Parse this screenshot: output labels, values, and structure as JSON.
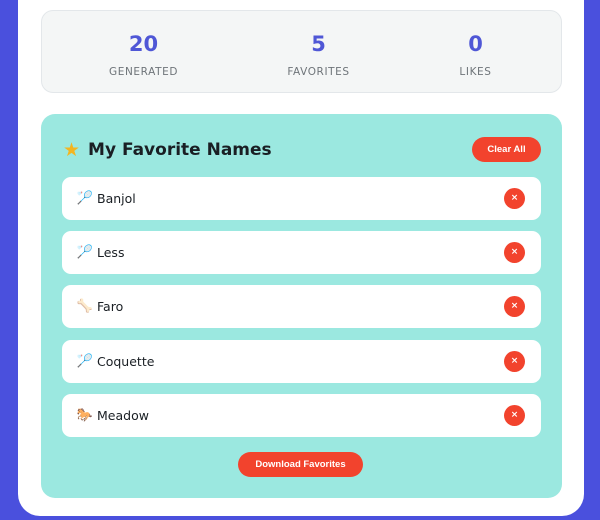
{
  "stats": [
    {
      "value": "20",
      "label": "GENERATED"
    },
    {
      "value": "5",
      "label": "FAVORITES"
    },
    {
      "value": "0",
      "label": "LIKES"
    }
  ],
  "favorites": {
    "title": "My Favorite Names",
    "title_icon": "star-icon",
    "clear_label": "Clear All",
    "download_label": "Download Favorites",
    "remove_symbol": "×",
    "items": [
      {
        "name": "Banjol",
        "icon": "tennis-racket-icon",
        "glyph": "🏸"
      },
      {
        "name": "Less",
        "icon": "tennis-racket-icon",
        "glyph": "🏸"
      },
      {
        "name": "Faro",
        "icon": "bone-icon",
        "glyph": "🦴"
      },
      {
        "name": "Coquette",
        "icon": "tennis-racket-icon",
        "glyph": "🏸"
      },
      {
        "name": "Meadow",
        "icon": "horse-icon",
        "glyph": "🐎"
      }
    ]
  },
  "colors": {
    "background": "#4a50dd",
    "accent": "#4f57d6",
    "panel": "#9be8e0",
    "danger": "#f2432d"
  }
}
